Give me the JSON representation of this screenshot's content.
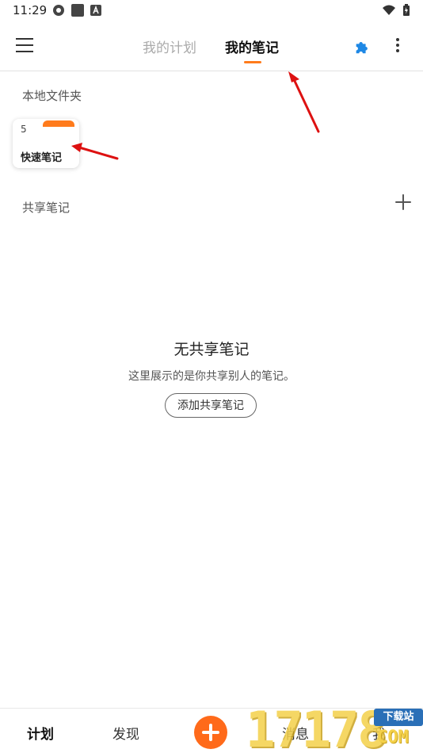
{
  "status_bar": {
    "time": "11:29"
  },
  "header": {
    "tabs": [
      {
        "label": "我的计划",
        "active": false
      },
      {
        "label": "我的笔记",
        "active": true
      }
    ],
    "accent_color": "#ff7b1c",
    "icons": [
      "menu-icon",
      "puzzle-icon",
      "more-vert-icon"
    ]
  },
  "local_folders": {
    "title": "本地文件夹",
    "items": [
      {
        "count": "5",
        "name": "快速笔记"
      }
    ]
  },
  "shared_notes": {
    "title": "共享笔记",
    "empty_title": "无共享笔记",
    "empty_desc": "这里展示的是你共享别人的笔记。",
    "add_button": "添加共享笔记"
  },
  "bottom_nav": {
    "items": [
      {
        "label": "计划",
        "active": true
      },
      {
        "label": "发现",
        "active": false
      },
      {
        "label": "消息",
        "active": false
      },
      {
        "label": "我",
        "active": false
      }
    ],
    "fab_color": "#ff6a1a"
  },
  "watermark": {
    "digits": "17178",
    "badge": "下载站",
    "suffix": "COM"
  }
}
